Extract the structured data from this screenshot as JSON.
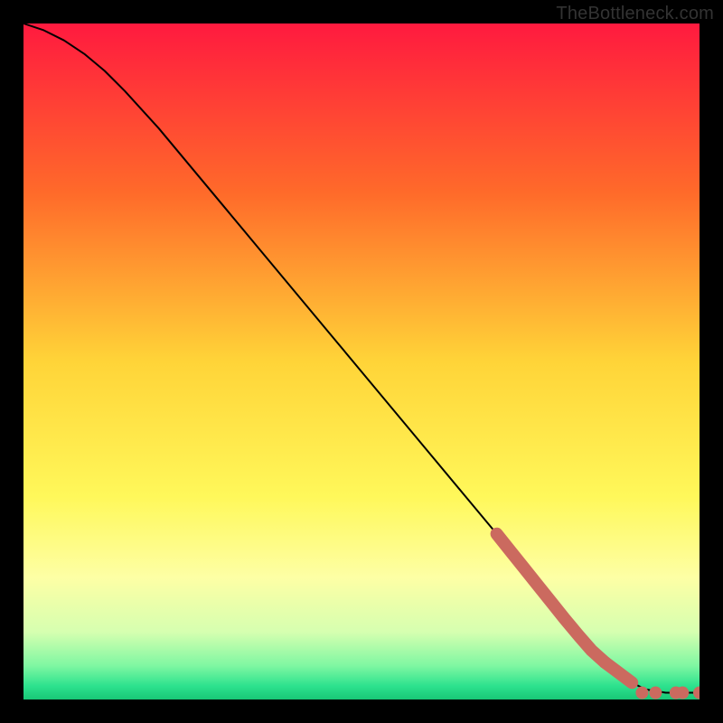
{
  "attribution": "TheBottleneck.com",
  "chart_data": {
    "type": "line",
    "title": "",
    "xlabel": "",
    "ylabel": "",
    "x_range": [
      0,
      100
    ],
    "y_range": [
      0,
      100
    ],
    "legend": false,
    "grid": false,
    "series": [
      {
        "name": "curve",
        "type": "line",
        "color": "#000000",
        "x": [
          0,
          3,
          6,
          9,
          12,
          15,
          20,
          25,
          30,
          35,
          40,
          45,
          50,
          55,
          60,
          65,
          70,
          72,
          74,
          76,
          78,
          80,
          83,
          86,
          89,
          92,
          95,
          98,
          100
        ],
        "y": [
          100,
          99,
          97.5,
          95.5,
          93,
          90,
          84.5,
          78.5,
          72.5,
          66.5,
          60.5,
          54.5,
          48.5,
          42.5,
          36.5,
          30.5,
          24.5,
          22,
          19.5,
          17,
          14.5,
          12,
          8.5,
          5.5,
          3,
          1.5,
          1,
          1,
          1
        ]
      },
      {
        "name": "highlight-upper",
        "type": "line",
        "color": "#cb6a5f",
        "stroke_width": 14,
        "x": [
          70,
          72,
          74,
          76,
          78,
          80,
          82,
          84,
          86
        ],
        "y": [
          24.5,
          22,
          19.5,
          17,
          14.5,
          12,
          9.6,
          7.3,
          5.5
        ]
      },
      {
        "name": "highlight-lower",
        "type": "line",
        "color": "#cb6a5f",
        "stroke_width": 14,
        "x": [
          86,
          88,
          90
        ],
        "y": [
          5.5,
          4,
          2.5
        ]
      },
      {
        "name": "tail-dots",
        "type": "scatter",
        "color": "#cb6a5f",
        "marker_size": 14,
        "x": [
          91.5,
          93.5,
          96.5,
          97.5,
          100
        ],
        "y": [
          1,
          1,
          1,
          1,
          1
        ]
      }
    ],
    "background": {
      "type": "vertical-gradient",
      "stops": [
        {
          "offset": 0.0,
          "color": "#ff1a3f"
        },
        {
          "offset": 0.25,
          "color": "#ff6a2a"
        },
        {
          "offset": 0.5,
          "color": "#ffd438"
        },
        {
          "offset": 0.7,
          "color": "#fff85a"
        },
        {
          "offset": 0.82,
          "color": "#fdffa5"
        },
        {
          "offset": 0.9,
          "color": "#d6ffb0"
        },
        {
          "offset": 0.95,
          "color": "#7ff7a2"
        },
        {
          "offset": 0.98,
          "color": "#2de28e"
        },
        {
          "offset": 1.0,
          "color": "#18c776"
        }
      ]
    }
  }
}
